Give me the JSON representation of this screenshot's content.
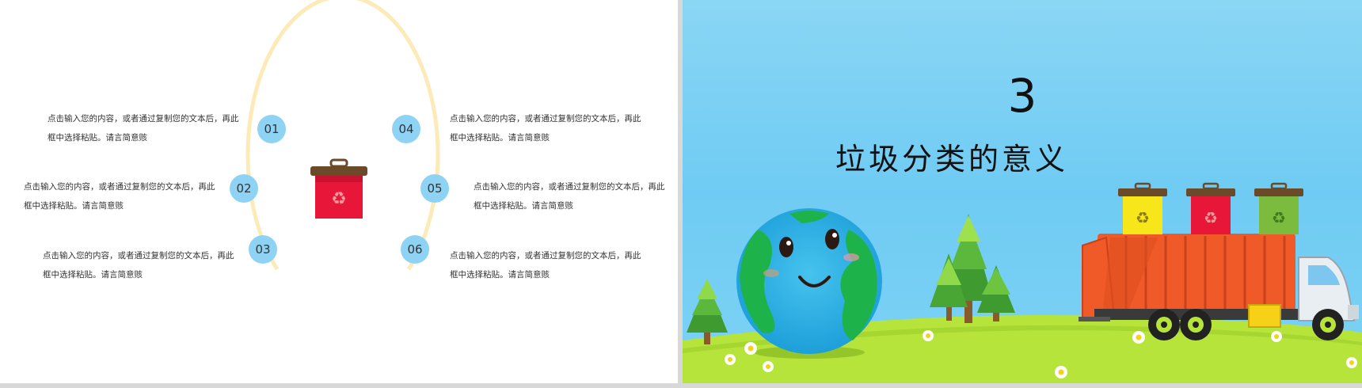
{
  "left_slide": {
    "items": [
      {
        "num": "01",
        "text_line1": "点击输入您的内容，或者通过复制您的文本后，再此",
        "text_line2": "框中选择粘贴。请言简意赅"
      },
      {
        "num": "02",
        "text_line1": "点击输入您的内容，或者通过复制您的文本后，再此",
        "text_line2": "框中选择粘贴。请言简意赅"
      },
      {
        "num": "03",
        "text_line1": "点击输入您的内容，或者通过复制您的文本后，再此",
        "text_line2": "框中选择粘贴。请言简意赅"
      },
      {
        "num": "04",
        "text_line1": "点击输入您的内容，或者通过复制您的文本后，再此",
        "text_line2": "框中选择粘贴。请言简意赅"
      },
      {
        "num": "05",
        "text_line1": "点击输入您的内容，或者通过复制您的文本后，再此",
        "text_line2": "框中选择粘贴。请言简意赅"
      },
      {
        "num": "06",
        "text_line1": "点击输入您的内容，或者通过复制您的文本后，再此",
        "text_line2": "框中选择粘贴。请言简意赅"
      }
    ],
    "colors": {
      "arc": "#fcebb8",
      "circle": "#8fd3f4",
      "bin": "#e8173a"
    }
  },
  "right_slide": {
    "section_number": "3",
    "section_title": "垃圾分类的意义",
    "colors": {
      "sky": "#7dd2f4",
      "ground": "#b7e43a",
      "truck": "#f05a28"
    }
  }
}
